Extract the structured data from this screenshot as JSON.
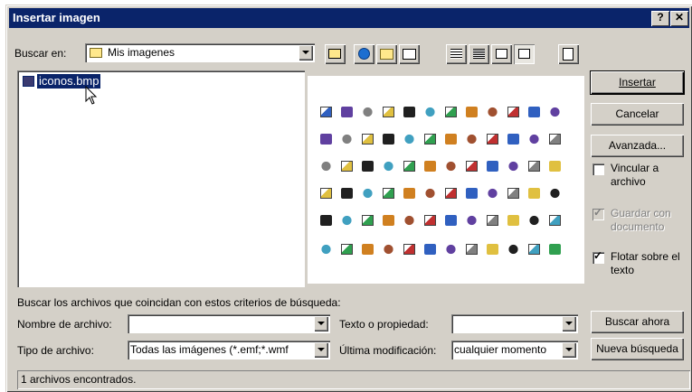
{
  "window": {
    "title": "Insertar imagen",
    "help_label": "?",
    "close_label": "✕"
  },
  "lookin": {
    "label": "Buscar en:",
    "value": "Mis imagenes"
  },
  "files": [
    {
      "name": "iconos.bmp"
    }
  ],
  "buttons": {
    "insert": "Insertar",
    "cancel": "Cancelar",
    "advanced": "Avanzada...",
    "search_now": "Buscar ahora",
    "new_search": "Nueva búsqueda"
  },
  "options": {
    "link": {
      "label": "Vincular a archivo",
      "checked": false
    },
    "save_with_doc": {
      "label": "Guardar con documento",
      "checked": true,
      "disabled": true
    },
    "float": {
      "label": "Flotar sobre el texto",
      "checked": true
    }
  },
  "criteria": {
    "heading": "Buscar los archivos que coincidan con estos criterios de búsqueda:",
    "filename_label": "Nombre de archivo:",
    "filename_value": "",
    "text_label": "Texto o propiedad:",
    "text_value": "",
    "type_label": "Tipo de archivo:",
    "type_value": "Todas las imágenes (*.emf;*.wmf",
    "modified_label": "Última modificación:",
    "modified_value": "cualquier momento"
  },
  "status": "1 archivos encontrados.",
  "colors": {
    "titlebar": "#0a246a",
    "selection": "#0a246a",
    "face": "#d4d0c8"
  }
}
